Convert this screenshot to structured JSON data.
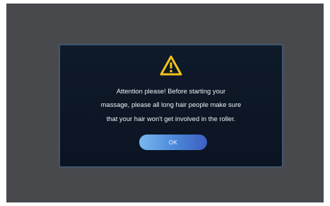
{
  "dialog": {
    "icon": "warning-icon",
    "message_lines": [
      "Attention please! Before starting your",
      "massage, please all long hair people make sure",
      "that your hair won't get involved in the roller."
    ],
    "ok_label": "OK"
  },
  "colors": {
    "screen_bg": "#48494d",
    "dialog_bg": "#0f1a2a",
    "warning_yellow": "#f2c21a",
    "button_start": "#79b7ee",
    "button_end": "#3e5fc2"
  }
}
